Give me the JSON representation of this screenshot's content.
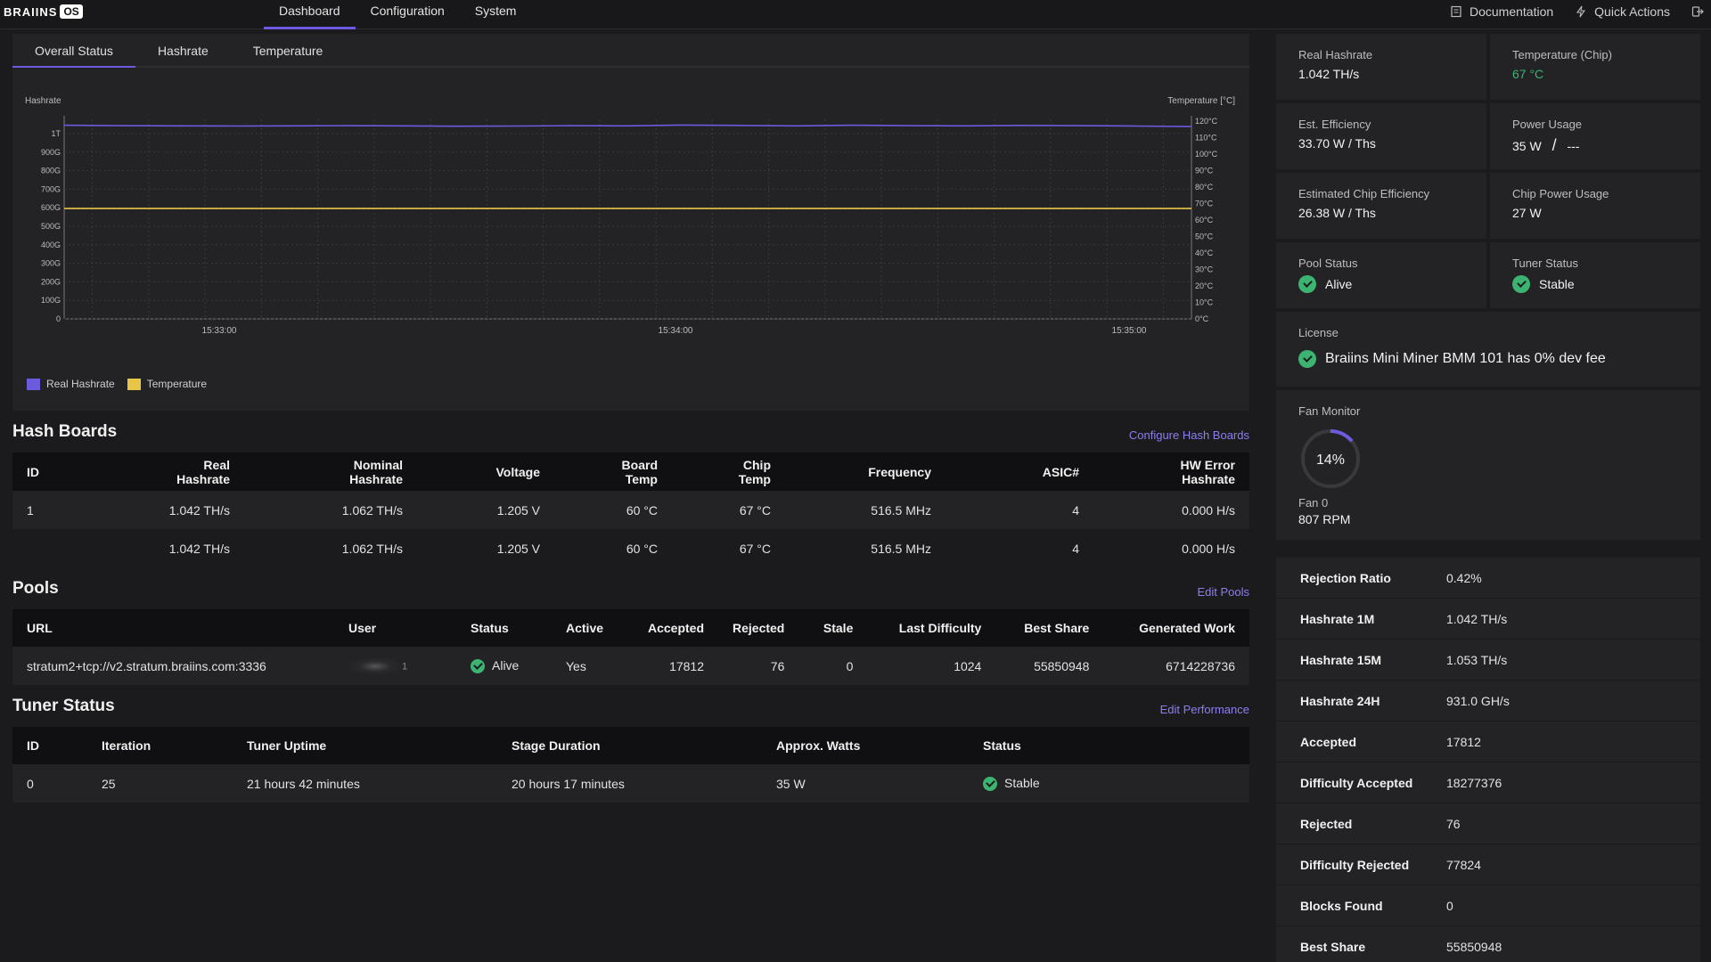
{
  "brand": {
    "logo_text": "BRAIINS",
    "logo_badge": "OS"
  },
  "nav": {
    "items": [
      {
        "label": "Dashboard",
        "active": true
      },
      {
        "label": "Configuration",
        "active": false
      },
      {
        "label": "System",
        "active": false
      }
    ],
    "documentation": "Documentation",
    "quick_actions": "Quick Actions"
  },
  "chart_tabs": [
    "Overall Status",
    "Hashrate",
    "Temperature"
  ],
  "chart_data": {
    "type": "line",
    "ylabel_left": "Hashrate",
    "ylabel_right": "Temperature [°C]",
    "left_ticks": [
      "1T",
      "900G",
      "800G",
      "700G",
      "600G",
      "500G",
      "400G",
      "300G",
      "200G",
      "100G",
      "0"
    ],
    "right_ticks": [
      "120°C",
      "110°C",
      "100°C",
      "90°C",
      "80°C",
      "70°C",
      "60°C",
      "50°C",
      "40°C",
      "30°C",
      "20°C",
      "10°C",
      "0°C"
    ],
    "x_ticks": [
      "15:33:00",
      "15:34:00",
      "15:35:00"
    ],
    "series": [
      {
        "name": "Real Hashrate",
        "color": "#6b5bdf",
        "unit": "TH/s",
        "values": [
          1.045,
          1.043,
          1.042,
          1.041,
          1.042,
          1.043,
          1.042,
          1.04,
          1.041,
          1.043,
          1.042,
          1.046,
          1.044,
          1.042,
          1.045,
          1.043,
          1.042,
          1.044,
          1.043,
          1.041,
          1.038
        ]
      },
      {
        "name": "Temperature",
        "color": "#e8c547",
        "unit": "°C",
        "values": [
          67,
          67,
          67,
          67,
          67,
          67,
          67,
          67,
          67,
          67,
          67,
          67,
          67,
          67,
          67,
          67,
          67,
          67,
          67,
          67,
          67
        ]
      }
    ],
    "y_left_range": [
      0,
      1.0
    ],
    "y_right_range": [
      0,
      120
    ],
    "grid": true,
    "legend": "bottom-left"
  },
  "hash_boards": {
    "title": "Hash Boards",
    "action": "Configure Hash Boards",
    "columns": [
      "ID",
      "Real\nHashrate",
      "Nominal\nHashrate",
      "Voltage",
      "Board\nTemp",
      "Chip\nTemp",
      "Frequency",
      "ASIC#",
      "HW Error\nHashrate"
    ],
    "rows": [
      [
        "1",
        "1.042  TH/s",
        "1.062  TH/s",
        "1.205 V",
        "60 °C",
        "67 °C",
        "516.5 MHz",
        "4",
        "0.000  H/s"
      ],
      [
        "",
        "1.042  TH/s",
        "1.062  TH/s",
        "1.205 V",
        "60 °C",
        "67 °C",
        "516.5 MHz",
        "4",
        "0.000  H/s"
      ]
    ]
  },
  "pools": {
    "title": "Pools",
    "action": "Edit Pools",
    "columns": [
      "URL",
      "User",
      "Status",
      "Active",
      "Accepted",
      "Rejected",
      "Stale",
      "Last Difficulty",
      "Best Share",
      "Generated Work"
    ],
    "rows": [
      {
        "url": "stratum2+tcp://v2.stratum.braiins.com:3336",
        "user_suffix": "1",
        "status": "Alive",
        "active": "Yes",
        "accepted": "17812",
        "rejected": "76",
        "stale": "0",
        "last_difficulty": "1024",
        "best_share": "55850948",
        "generated_work": "6714228736"
      }
    ]
  },
  "tuner": {
    "title": "Tuner Status",
    "action": "Edit Performance",
    "columns": [
      "ID",
      "Iteration",
      "Tuner Uptime",
      "Stage Duration",
      "Approx. Watts",
      "Status"
    ],
    "rows": [
      {
        "id": "0",
        "iteration": "25",
        "uptime": "21 hours 42 minutes",
        "stage": "20 hours 17 minutes",
        "watts": "35 W",
        "status": "Stable"
      }
    ]
  },
  "cards": {
    "real_hashrate": {
      "label": "Real Hashrate",
      "value": "1.042  TH/s"
    },
    "chip_temp": {
      "label": "Temperature (Chip)",
      "value": "67 °C"
    },
    "efficiency": {
      "label": "Est. Efficiency",
      "value": "33.70 W / Ths"
    },
    "power": {
      "label": "Power Usage",
      "value": "35 W",
      "sep": "/",
      "max": "---"
    },
    "chip_efficiency": {
      "label": "Estimated Chip Efficiency",
      "value": "26.38 W / Ths"
    },
    "chip_power": {
      "label": "Chip Power Usage",
      "value": "27 W"
    },
    "pool_status": {
      "label": "Pool Status",
      "value": "Alive"
    },
    "tuner_status": {
      "label": "Tuner Status",
      "value": "Stable"
    }
  },
  "license": {
    "label": "License",
    "value": "Braiins Mini Miner BMM 101 has 0% dev fee"
  },
  "fan": {
    "label": "Fan Monitor",
    "percent": 14,
    "percent_text": "14%",
    "fan_name": "Fan 0",
    "rpm": "807 RPM"
  },
  "stats": [
    {
      "k": "Rejection Ratio",
      "v": "0.42%"
    },
    {
      "k": "Hashrate 1M",
      "v": "1.042  TH/s"
    },
    {
      "k": "Hashrate 15M",
      "v": "1.053  TH/s"
    },
    {
      "k": "Hashrate 24H",
      "v": "931.0  GH/s"
    },
    {
      "k": "Accepted",
      "v": "17812"
    },
    {
      "k": "Difficulty Accepted",
      "v": "18277376"
    },
    {
      "k": "Rejected",
      "v": "76"
    },
    {
      "k": "Difficulty Rejected",
      "v": "77824"
    },
    {
      "k": "Blocks Found",
      "v": "0"
    },
    {
      "k": "Best Share",
      "v": "55850948"
    }
  ]
}
